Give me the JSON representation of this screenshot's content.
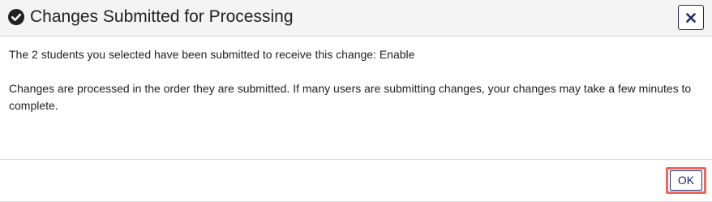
{
  "dialog": {
    "title": "Changes Submitted for Processing",
    "message_line1": "The 2 students you selected have been submitted to receive this change: Enable",
    "message_line2": "Changes are processed in the order they are submitted. If many users are submitting changes, your changes may take a few minutes to complete.",
    "ok_label": "OK",
    "title_icon": "check-circle-icon",
    "close_icon": "close-icon"
  },
  "colors": {
    "header_bg": "#f4f4f4",
    "button_accent": "#1f2a66",
    "highlight": "#f0655c"
  }
}
